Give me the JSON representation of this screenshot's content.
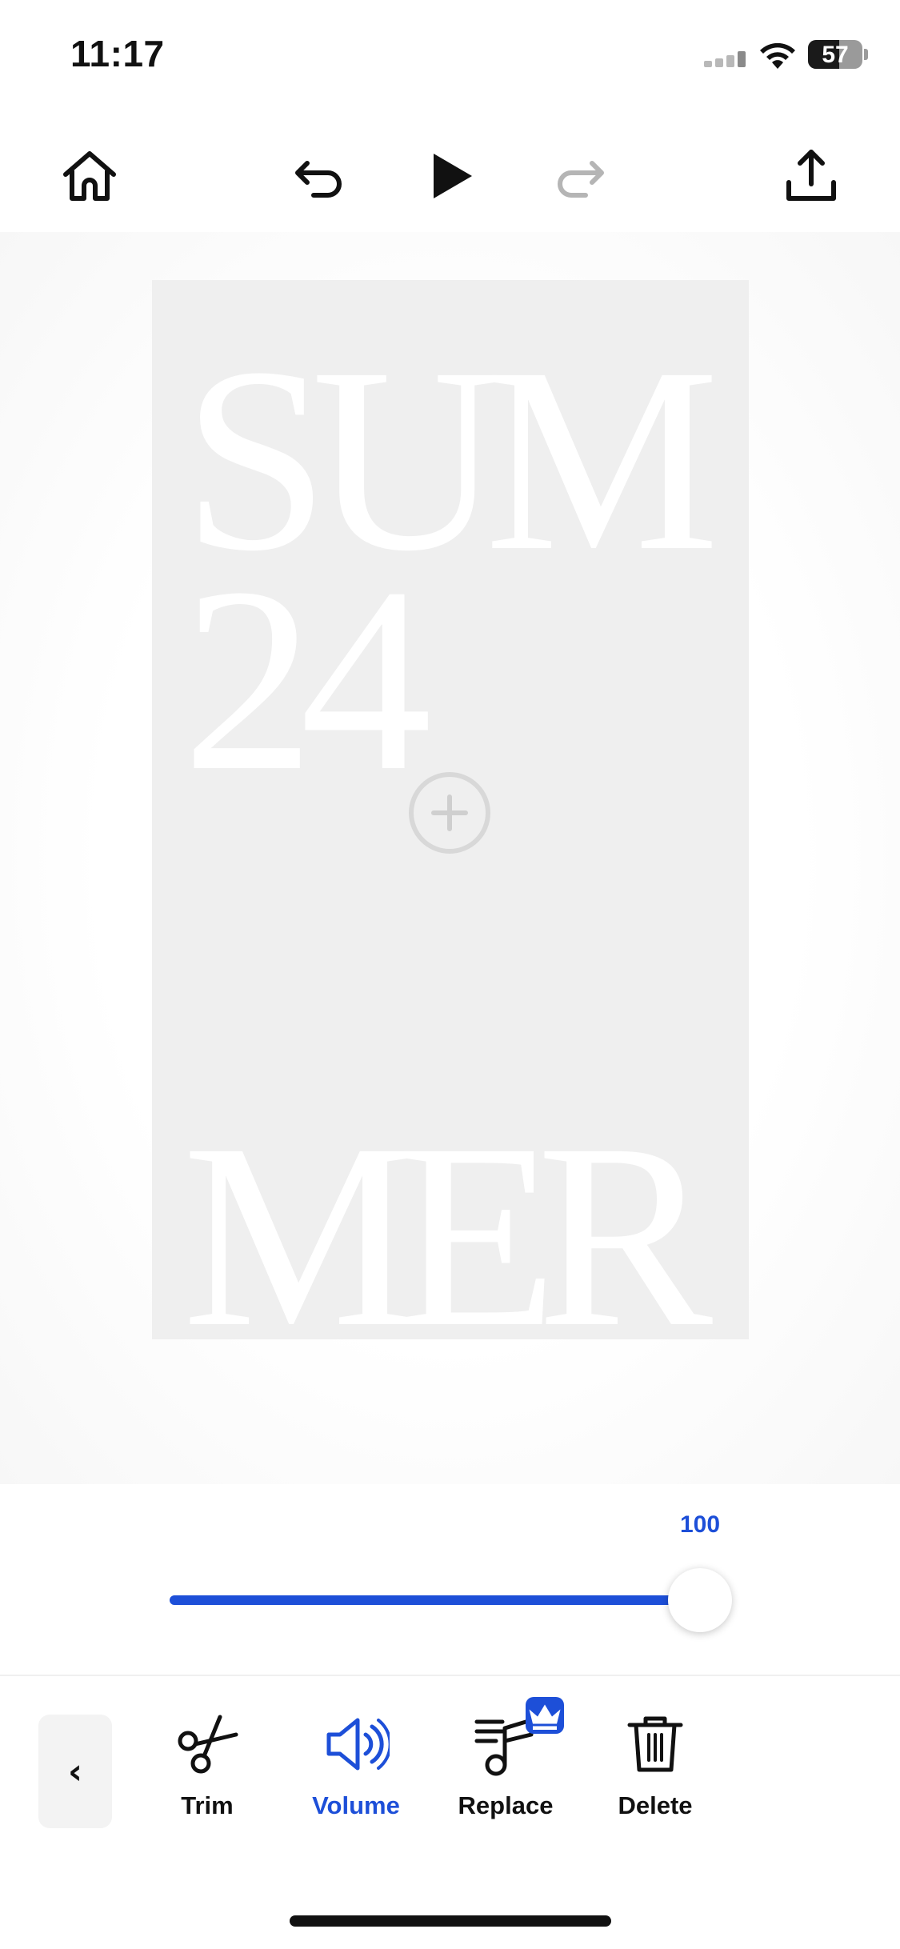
{
  "status_bar": {
    "time": "11:17",
    "battery_level": "57",
    "battery_percent": 57
  },
  "toolbar": {
    "icons": [
      "home-icon",
      "undo-icon",
      "play-icon",
      "redo-icon",
      "share-icon"
    ],
    "redo_enabled": false
  },
  "canvas": {
    "background_color": "#efefef",
    "text_color": "#ffffff",
    "line1": "SUM",
    "line2": "24",
    "line3": "MER",
    "add_icon": "plus-circle-icon"
  },
  "volume": {
    "value_label": "100",
    "value": 100,
    "min": 0,
    "max": 100,
    "accent_color": "#1d4fd8"
  },
  "tools": {
    "back_label": "‹",
    "items": [
      {
        "label": "Trim",
        "icon": "scissors-icon",
        "active": false
      },
      {
        "label": "Volume",
        "icon": "speaker-icon",
        "active": true
      },
      {
        "label": "Replace",
        "icon": "music-replace-icon",
        "active": false,
        "premium": true
      },
      {
        "label": "Delete",
        "icon": "trash-icon",
        "active": false
      }
    ]
  }
}
